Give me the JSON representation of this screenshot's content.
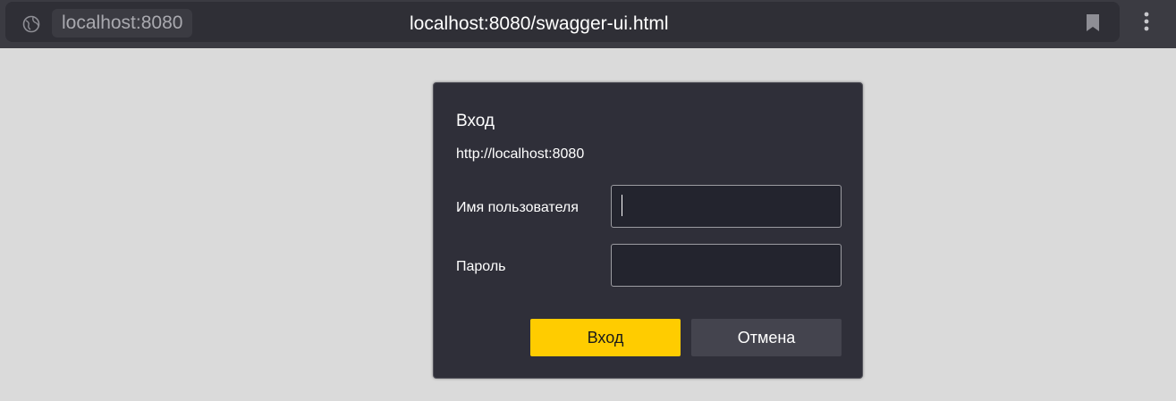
{
  "browser": {
    "host_chip": "localhost:8080",
    "url": "localhost:8080/swagger-ui.html",
    "icons": {
      "site": "globe-icon",
      "bookmark": "bookmark-icon",
      "menu": "kebab-menu-icon"
    }
  },
  "auth_dialog": {
    "title": "Вход",
    "origin": "http://localhost:8080",
    "username_label": "Имя пользователя",
    "username_value": "",
    "password_label": "Пароль",
    "password_value": "",
    "submit_label": "Вход",
    "cancel_label": "Отмена"
  },
  "colors": {
    "accent": "#ffcc00",
    "dialog_bg": "#2f2f39",
    "page_bg": "#dadada"
  }
}
